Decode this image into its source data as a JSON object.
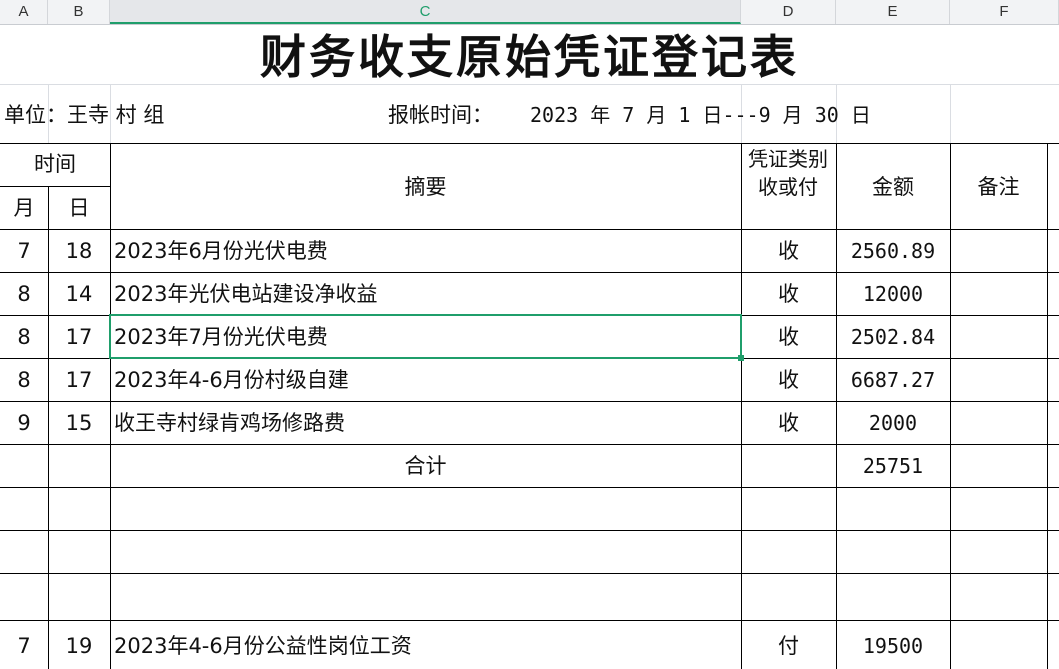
{
  "column_headers": [
    "A",
    "B",
    "C",
    "D",
    "E",
    "F"
  ],
  "active_column": "C",
  "title": "财务收支原始凭证登记表",
  "unit_label": "单位：王寺  村   组",
  "period_label": "报帐时间：",
  "period_value": "2023 年 7 月 1 日---9  月 30 日",
  "header": {
    "time": "时间",
    "month": "月",
    "day": "日",
    "summary": "摘要",
    "voucher_type": "凭证类别收或付",
    "amount": "金额",
    "remark": "备注"
  },
  "rows": [
    {
      "month": "7",
      "day": "18",
      "summary": "2023年6月份光伏电费",
      "type": "收",
      "amount": "2560.89",
      "remark": ""
    },
    {
      "month": "8",
      "day": "14",
      "summary": "2023年光伏电站建设净收益",
      "type": "收",
      "amount": "12000",
      "remark": ""
    },
    {
      "month": "8",
      "day": "17",
      "summary": "2023年7月份光伏电费",
      "type": "收",
      "amount": "2502.84",
      "remark": ""
    },
    {
      "month": "8",
      "day": "17",
      "summary": "2023年4-6月份村级自建",
      "type": "收",
      "amount": "6687.27",
      "remark": ""
    },
    {
      "month": "9",
      "day": "15",
      "summary": "收王寺村绿肯鸡场修路费",
      "type": "收",
      "amount": "2000",
      "remark": ""
    }
  ],
  "total": {
    "label": "合计",
    "amount": "25751"
  },
  "bottom_row": {
    "month": "7",
    "day": "19",
    "summary": "2023年4-6月份公益性岗位工资",
    "type": "付",
    "amount": "19500",
    "remark": ""
  },
  "selection_color": "#1f9e6b"
}
